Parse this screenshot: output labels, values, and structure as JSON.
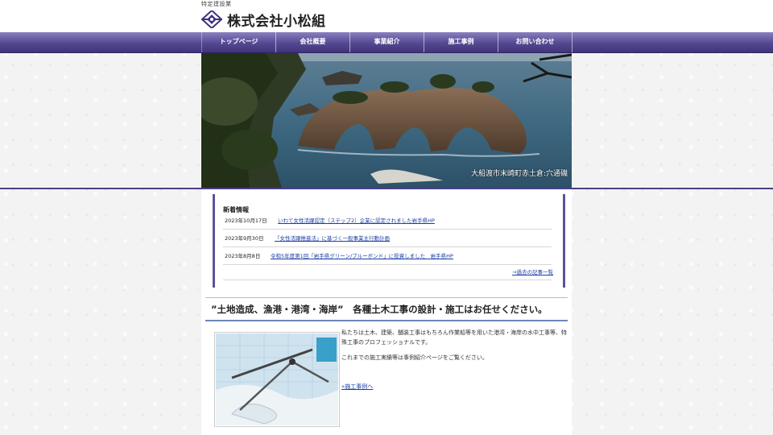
{
  "header": {
    "tagline": "特定建設業",
    "company_name": "株式会社小松組"
  },
  "nav": {
    "items": [
      {
        "label": "トップページ"
      },
      {
        "label": "会社概要"
      },
      {
        "label": "事業紹介"
      },
      {
        "label": "施工事例"
      },
      {
        "label": "お問い合わせ"
      }
    ]
  },
  "hero": {
    "caption": "大船渡市末崎町赤土倉:穴通磯"
  },
  "news": {
    "title": "新着情報",
    "items": [
      {
        "date": "2023年10月17日",
        "text": "いわて女性活躍認定（ステップ2）企業に認定されました岩手県HP"
      },
      {
        "date": "2023年9月30日",
        "text": "「女性活躍推進法」に基づく一般事業主行動計画"
      },
      {
        "date": "2023年8月8日",
        "text": "令和5年度第1回「岩手県グリーン/ブルーボンド」に投資しました　岩手県HP"
      }
    ],
    "archive_link": "→過去の記事一覧"
  },
  "intro": {
    "headline": "”土地造成、漁港・港湾・海岸”　各種土木工事の設計・施工はお任せください。",
    "paragraph1": "私たちは土木、建築、舗装工事はもちろん作業船等を用いた港湾・海岸の水中工事等、特殊工事のプロフェッショナルです。",
    "paragraph2": "これまでの施工実績等は事例紹介ページをご覧ください。",
    "works_link": "»施工事例へ"
  },
  "colors": {
    "nav": "#544892",
    "accent_border": "#5d5299",
    "link": "#1a3fa6"
  }
}
